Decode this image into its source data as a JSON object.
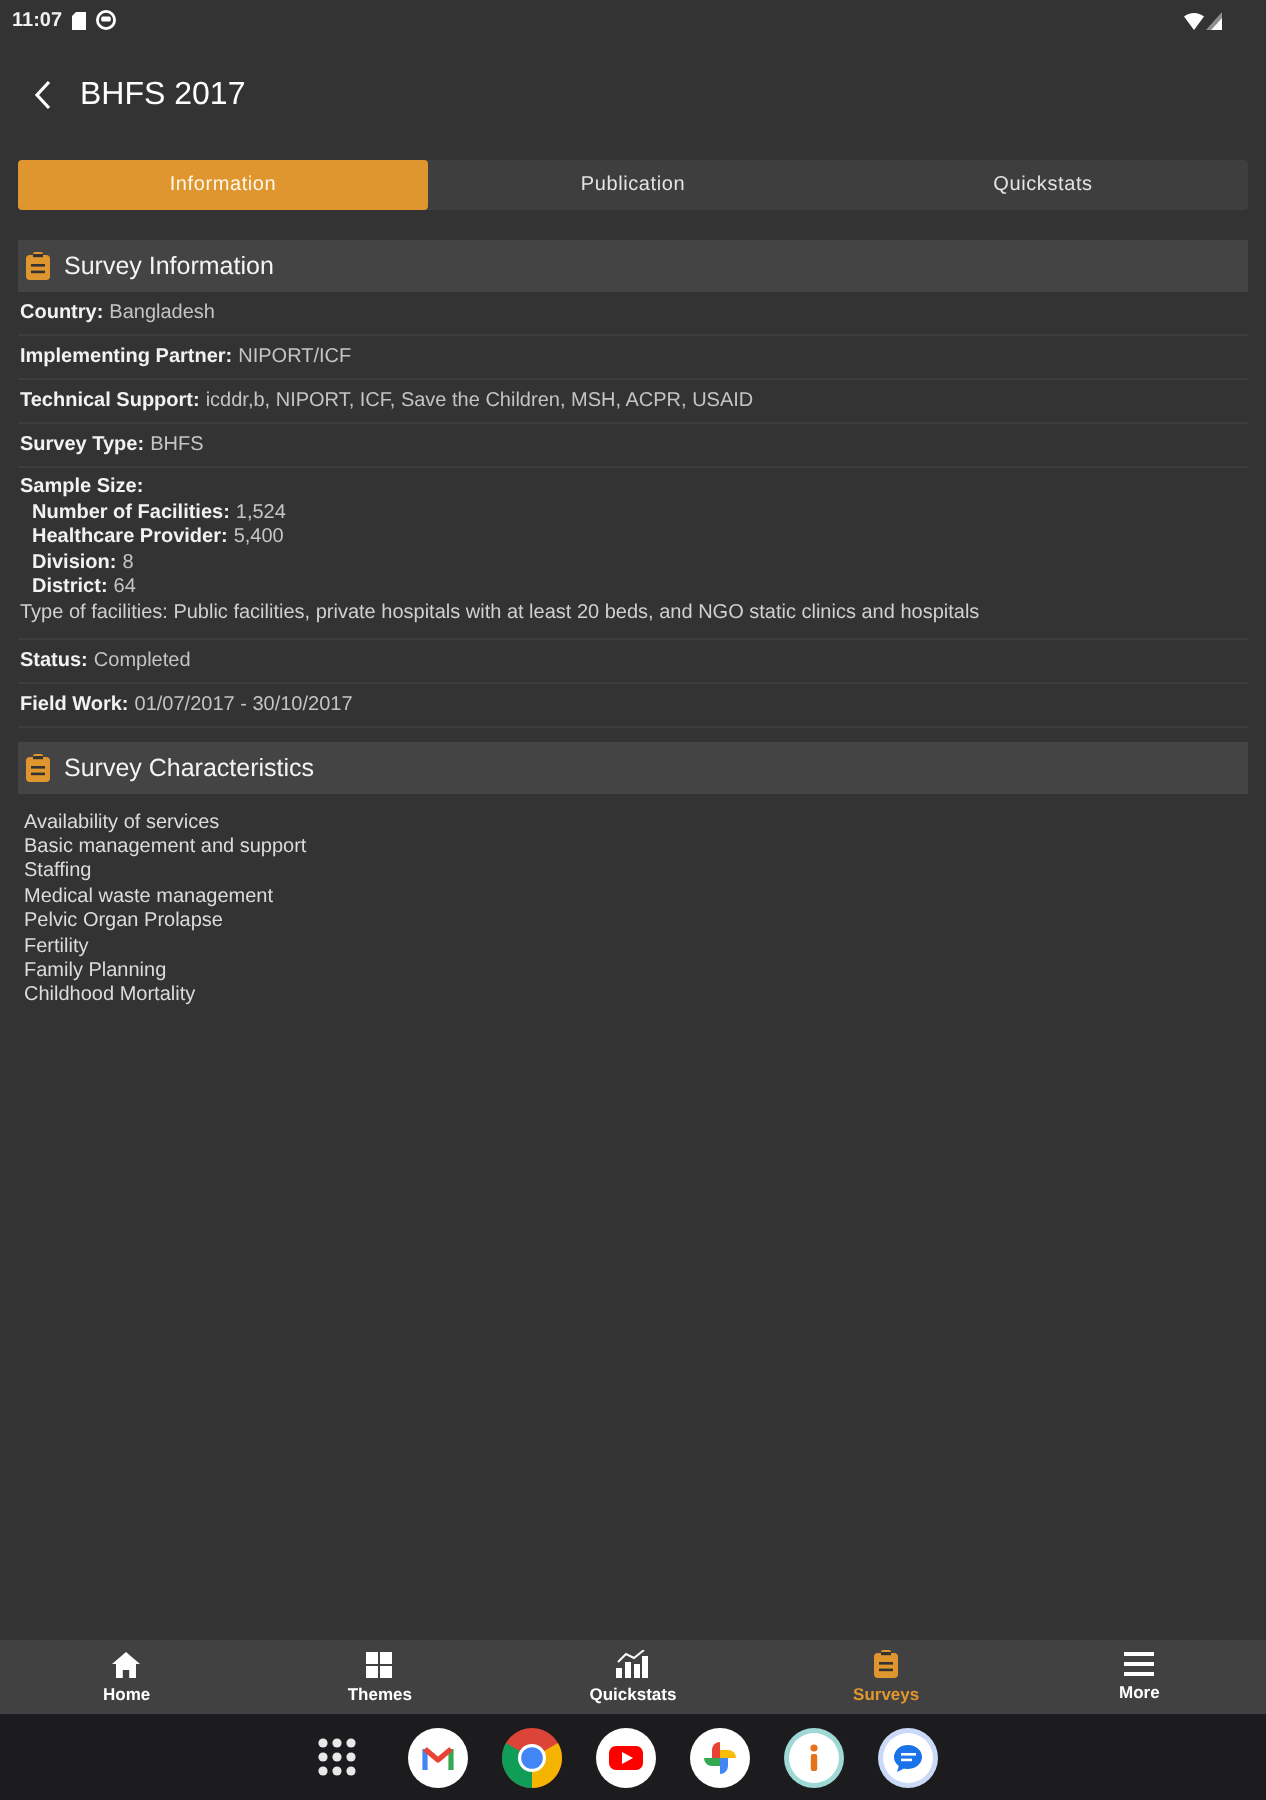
{
  "status_bar": {
    "time": "11:07"
  },
  "app_bar": {
    "title": "BHFS 2017"
  },
  "tabs": [
    {
      "label": "Information",
      "selected": true
    },
    {
      "label": "Publication",
      "selected": false
    },
    {
      "label": "Quickstats",
      "selected": false
    }
  ],
  "sections": [
    {
      "kind": "fields",
      "title": "Survey Information",
      "fields": [
        {
          "kind": "pair",
          "label": "Country:",
          "value": "Bangladesh"
        },
        {
          "kind": "pair",
          "label": "Implementing Partner:",
          "value": "NIPORT/ICF"
        },
        {
          "kind": "pair",
          "label": "Technical Support:",
          "value": "icddr,b, NIPORT, ICF, Save the Children, MSH, ACPR, USAID"
        },
        {
          "kind": "pair",
          "label": "Survey Type:",
          "value": "BHFS"
        },
        {
          "kind": "group",
          "label": "Sample Size:",
          "items": [
            {
              "label": "Number of Facilities:",
              "value": "1,524"
            },
            {
              "label": "Healthcare Provider:",
              "value": "5,400"
            },
            {
              "label": "Division:",
              "value": "8"
            },
            {
              "label": "District:",
              "value": "64"
            }
          ],
          "note": "Type of facilities: Public facilities, private hospitals with at least 20 beds, and NGO static clinics and hospitals"
        },
        {
          "kind": "pair",
          "label": "Status:",
          "value": "Completed"
        },
        {
          "kind": "pair",
          "label": "Field Work:",
          "value": "01/07/2017 - 30/10/2017"
        }
      ]
    },
    {
      "kind": "list",
      "title": "Survey Characteristics",
      "items": [
        "Availability of services",
        "Basic management and support",
        "Staffing",
        "Medical waste management",
        "Pelvic Organ Prolapse",
        "Fertility",
        "Family Planning",
        "Childhood Mortality"
      ]
    }
  ],
  "bottom_nav": [
    {
      "kind": "home",
      "label": "Home",
      "selected": false
    },
    {
      "kind": "themes",
      "label": "Themes",
      "selected": false
    },
    {
      "kind": "quickstats",
      "label": "Quickstats",
      "selected": false
    },
    {
      "kind": "surveys",
      "label": "Surveys",
      "selected": true
    },
    {
      "kind": "more",
      "label": "More",
      "selected": false
    }
  ]
}
